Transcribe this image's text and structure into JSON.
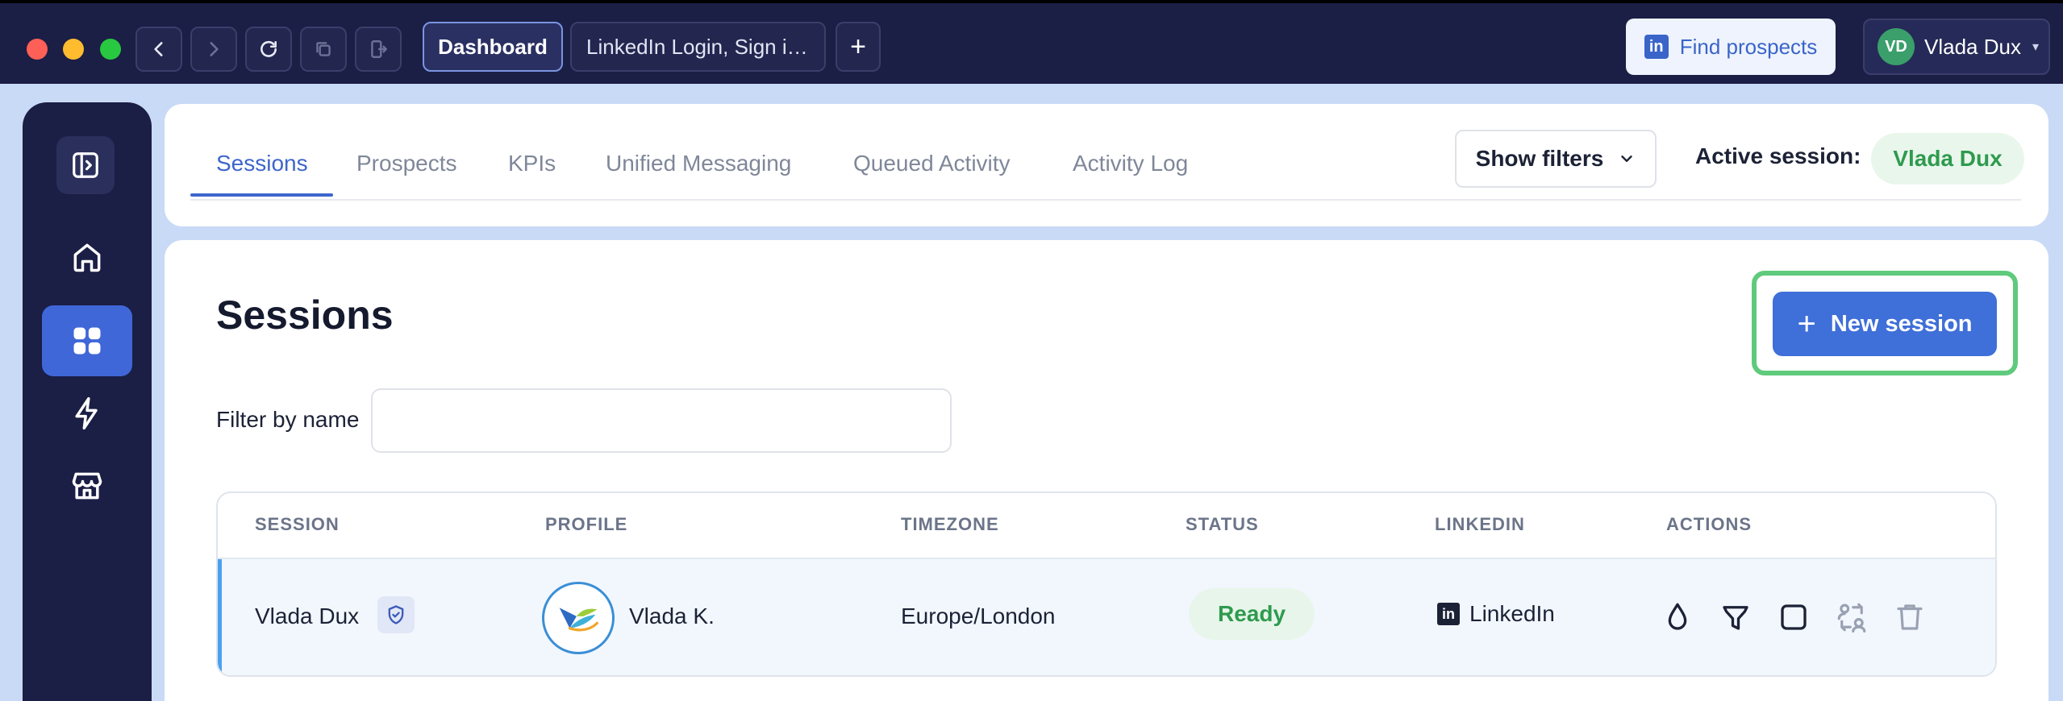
{
  "browser": {
    "tabs": [
      {
        "label": "Dashboard",
        "active": true
      },
      {
        "label": "LinkedIn Login, Sign in...",
        "active": false
      }
    ],
    "new_tab_symbol": "+",
    "find_prospects_label": "Find prospects",
    "linkedin_glyph": "in",
    "user": {
      "initials": "VD",
      "name": "Vlada Dux"
    }
  },
  "sidebar": {
    "items": [
      {
        "icon": "home-icon",
        "active": false
      },
      {
        "icon": "grid-icon",
        "active": true
      },
      {
        "icon": "lightning-icon",
        "active": false
      },
      {
        "icon": "store-icon",
        "active": false
      }
    ]
  },
  "nav_tabs": {
    "items": [
      "Sessions",
      "Prospects",
      "KPIs",
      "Unified Messaging",
      "Queued Activity",
      "Activity Log"
    ],
    "active": "Sessions"
  },
  "filters_button_label": "Show filters",
  "active_session": {
    "label": "Active session:",
    "name": "Vlada Dux"
  },
  "page": {
    "title": "Sessions",
    "new_session_label": "New session",
    "filter_label": "Filter by name",
    "filter_value": "",
    "filter_placeholder": ""
  },
  "table": {
    "headers": [
      "SESSION",
      "PROFILE",
      "TIMEZONE",
      "STATUS",
      "LINKEDIN",
      "ACTIONS"
    ],
    "rows": [
      {
        "session": "Vlada Dux",
        "profile": "Vlada K.",
        "timezone": "Europe/London",
        "status": "Ready",
        "linkedin": "LinkedIn",
        "actions": [
          "drop-icon",
          "funnel-icon",
          "square-icon",
          "switch-user-icon",
          "trash-icon"
        ]
      }
    ]
  },
  "colors": {
    "accent": "#3f67d8",
    "success": "#2e9a4e",
    "highlight_ring": "#5fca7c",
    "dark_nav": "#1b1e45"
  }
}
